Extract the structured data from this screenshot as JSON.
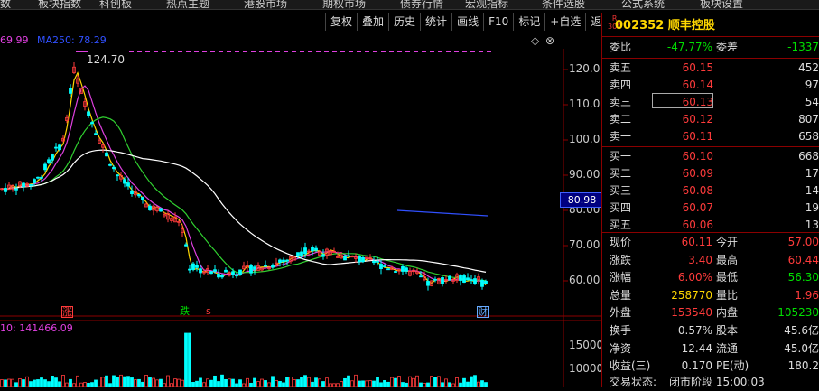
{
  "menu": [
    "数",
    "板块指数",
    "科创板",
    "热点主题",
    "港股市场",
    "期权市场",
    "债券行情",
    "宏观指标",
    "条件选股",
    "公式系统",
    "板块设置"
  ],
  "toolbar": [
    "复权",
    "叠加",
    "历史",
    "统计",
    "画线",
    "F10",
    "标记",
    "+自选",
    "返回"
  ],
  "legend": {
    "ma_prev": "69.99",
    "ma250_label": "MA250:",
    "ma250_value": "78.29"
  },
  "chart": {
    "high_label": "124.70",
    "current_box": "80.98",
    "y_ticks": [
      "120.0",
      "110.0",
      "100.0",
      "90.00",
      "80.00",
      "70.00",
      "60.00"
    ]
  },
  "markers": {
    "zhang": "涨",
    "die": "跌",
    "s": "s",
    "cai": "财"
  },
  "volume": {
    "legend_prefix": "10: ",
    "legend_value": "141466.09",
    "y_ticks": [
      "15000",
      "10000"
    ]
  },
  "colors": {
    "up": "#ff3b3b",
    "down": "#00e000",
    "ma_yellow": "#ffd700",
    "ma_magenta": "#e040e0",
    "ma_green": "#30d030",
    "ma_white": "#ffffff",
    "ma250": "#3050ff"
  },
  "stock": {
    "badge_top": "R",
    "badge_bottom": "300",
    "code": "002352",
    "name": "顺丰控股"
  },
  "weibi": {
    "label": "委比",
    "value": "-47.77%",
    "label2": "委差",
    "value2": "-1337"
  },
  "asks": [
    {
      "label": "卖五",
      "price": "60.15",
      "qty": "452"
    },
    {
      "label": "卖四",
      "price": "60.14",
      "qty": "97"
    },
    {
      "label": "卖三",
      "price": "60.13",
      "qty": "54"
    },
    {
      "label": "卖二",
      "price": "60.12",
      "qty": "807"
    },
    {
      "label": "卖一",
      "price": "60.11",
      "qty": "658"
    }
  ],
  "bids": [
    {
      "label": "买一",
      "price": "60.10",
      "qty": "668"
    },
    {
      "label": "买二",
      "price": "60.09",
      "qty": "17"
    },
    {
      "label": "买三",
      "price": "60.08",
      "qty": "14"
    },
    {
      "label": "买四",
      "price": "60.07",
      "qty": "19"
    },
    {
      "label": "买五",
      "price": "60.06",
      "qty": "13"
    }
  ],
  "quote": [
    {
      "l": "现价",
      "v": "60.11",
      "l2": "今开",
      "v2": "57.00"
    },
    {
      "l": "涨跌",
      "v": "3.40",
      "l2": "最高",
      "v2": "60.44"
    },
    {
      "l": "涨幅",
      "v": "6.00%",
      "l2": "最低",
      "v2": "56.30"
    },
    {
      "l": "总量",
      "v": "258770",
      "l2": "量比",
      "v2": "1.96"
    },
    {
      "l": "外盘",
      "v": "153540",
      "l2": "内盘",
      "v2": "105230"
    }
  ],
  "stats": [
    {
      "l": "换手",
      "v": "0.57%",
      "l2": "股本",
      "v2": "45.6亿"
    },
    {
      "l": "净资",
      "v": "12.44",
      "l2": "流通",
      "v2": "45.0亿"
    },
    {
      "l": "收益(三)",
      "v": "0.170",
      "l2": "PE(动)",
      "v2": "180.2"
    }
  ],
  "status": {
    "label": "交易状态:",
    "value": "闭市阶段 15:00:03"
  }
}
